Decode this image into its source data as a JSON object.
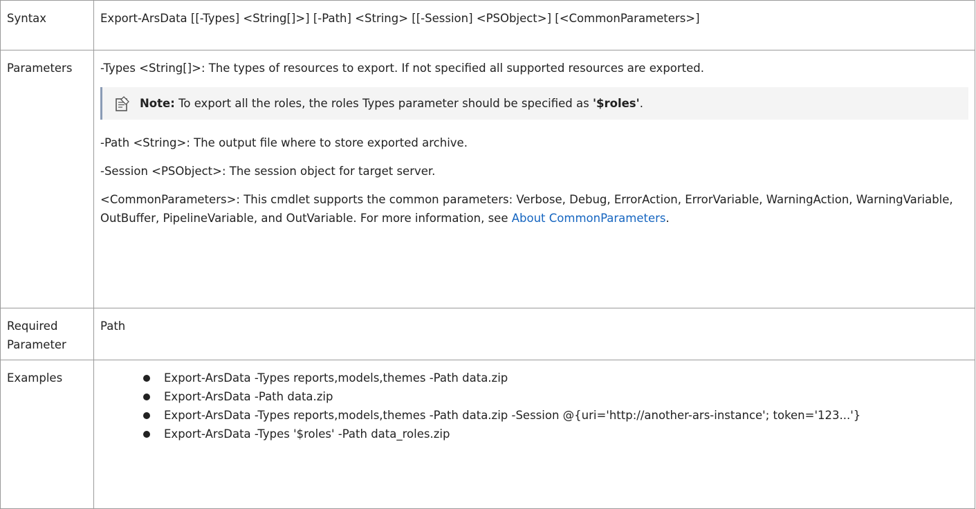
{
  "rows": {
    "syntax": {
      "label": "Syntax",
      "text": "Export-ArsData [[-Types] <String[]>] [-Path] <String> [[-Session] <PSObject>] [<CommonParameters>]"
    },
    "parameters": {
      "label": "Parameters",
      "types": "-Types <String[]>: The types of resources to export. If not specified all supported resources are exported.",
      "note": {
        "icon": "note-icon",
        "label": "Note:",
        "text": " To export all the roles, the roles Types parameter should be specified as ",
        "value": "'$roles'",
        "end": "."
      },
      "path": "-Path <String>: The output file where to store exported archive.",
      "session": "-Session <PSObject>: The session object for target server.",
      "common": "<CommonParameters>: This cmdlet supports the common parameters: Verbose, Debug, ErrorAction, ErrorVariable, WarningAction, WarningVariable, OutBuffer, PipelineVariable, and OutVariable. For more information, see ",
      "common_link": "About CommonParameters",
      "common_end": "."
    },
    "required": {
      "label": "Required Parameter",
      "value": "Path"
    },
    "examples": {
      "label": "Examples",
      "items": [
        "Export-ArsData -Types reports,models,themes -Path data.zip",
        "Export-ArsData -Path data.zip",
        "Export-ArsData -Types reports,models,themes -Path data.zip -Session @{uri='http://another-ars-instance'; token='123...'}",
        "Export-ArsData -Types '$roles' -Path data_roles.zip"
      ]
    }
  },
  "colors": {
    "link": "#1565c0",
    "border": "#9a9a9a",
    "note_bg": "#f4f4f4",
    "note_bar": "#8a9bb5"
  }
}
